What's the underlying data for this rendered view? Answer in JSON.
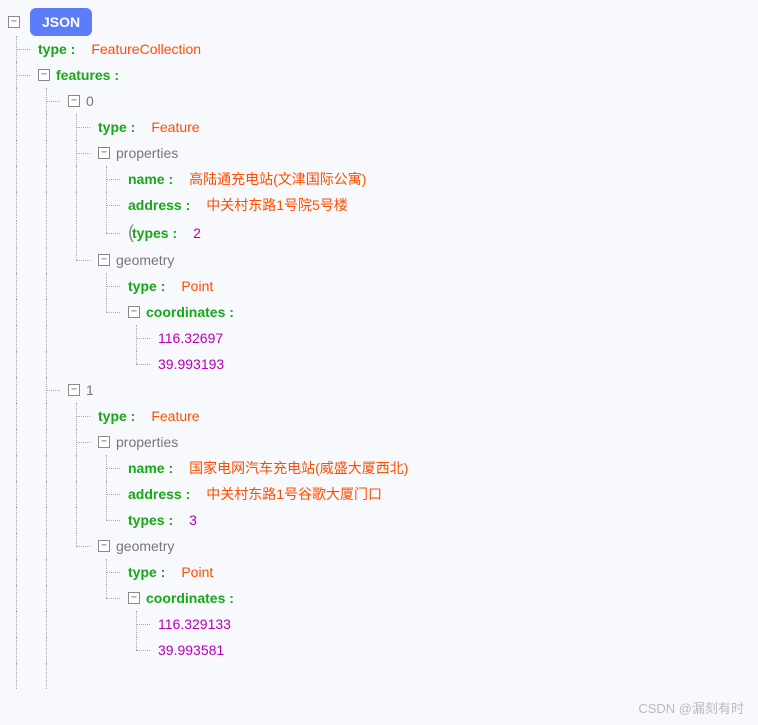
{
  "root_label": "JSON",
  "tree": {
    "type_key": "type :",
    "type_val": "FeatureCollection",
    "features_key": "features :",
    "items": [
      {
        "index": "0",
        "type_key": "type :",
        "type_val": "Feature",
        "properties_label": "properties",
        "name_key": "name :",
        "name_val": "高陆通充电站(文津国际公寓)",
        "address_key": "address :",
        "address_val": "中关村东路1号院5号楼",
        "types_key": "types :",
        "types_val": "2",
        "geometry_label": "geometry",
        "geom_type_key": "type :",
        "geom_type_val": "Point",
        "coords_key": "coordinates :",
        "coord0": "116.32697",
        "coord1": "39.993193"
      },
      {
        "index": "1",
        "type_key": "type :",
        "type_val": "Feature",
        "properties_label": "properties",
        "name_key": "name :",
        "name_val": "国家电网汽车充电站(威盛大厦西北)",
        "address_key": "address :",
        "address_val": "中关村东路1号谷歌大厦门口",
        "types_key": "types :",
        "types_val": "3",
        "geometry_label": "geometry",
        "geom_type_key": "type :",
        "geom_type_val": "Point",
        "coords_key": "coordinates :",
        "coord0": "116.329133",
        "coord1": "39.993581"
      }
    ]
  },
  "watermark": "CSDN @漏刻有时"
}
